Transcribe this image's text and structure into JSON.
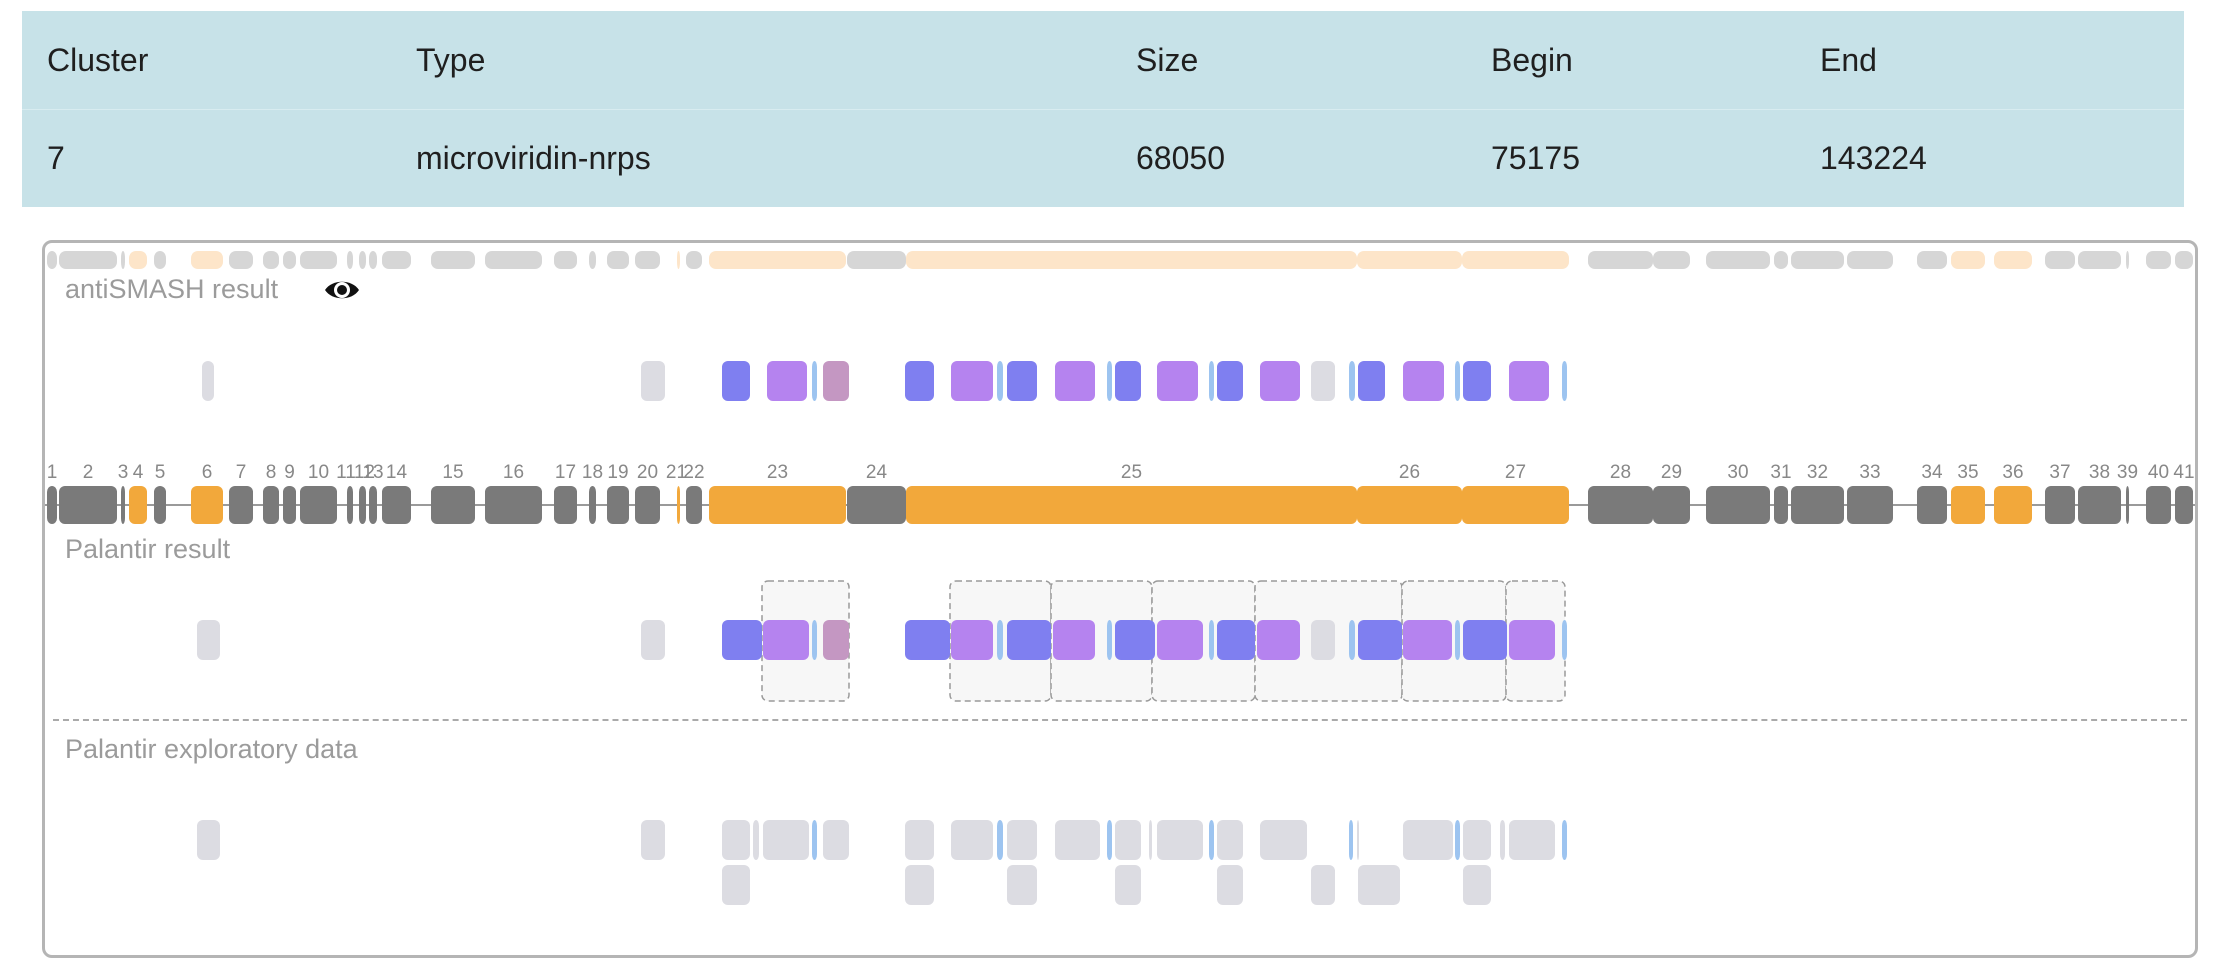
{
  "table": {
    "headers": [
      "Cluster",
      "Type",
      "Size",
      "Begin",
      "End"
    ],
    "row": [
      "7",
      "microviridin-nrps",
      "68050",
      "75175",
      "143224"
    ]
  },
  "viewer": {
    "antismash_label": "antiSMASH result",
    "palantir_label": "Palantir result",
    "exploratory_label": "Palantir exploratory data",
    "eye_icon": "eye-icon"
  },
  "colors": {
    "gene_core": "#f2a83b",
    "gene_other": "#7a7a7a",
    "gene_core_light": "#fde5c9",
    "gene_other_light": "#d6d6d6",
    "domain_blue": "#7f7ff0",
    "domain_violet": "#b583ef",
    "domain_mauve": "#c497c2",
    "domain_thin": "#9dc4f0",
    "domain_grey": "#dcdce2",
    "module_box": "#9a9a9a",
    "table_bg": "#c7e2e8"
  },
  "genes": [
    {
      "label": "1",
      "core": false
    },
    {
      "label": "2",
      "core": false
    },
    {
      "label": "3",
      "core": false
    },
    {
      "label": "4",
      "core": true
    },
    {
      "label": "5",
      "core": false
    },
    {
      "label": "6",
      "core": true
    },
    {
      "label": "7",
      "core": false
    },
    {
      "label": "8",
      "core": false
    },
    {
      "label": "9",
      "core": false
    },
    {
      "label": "10",
      "core": false
    },
    {
      "label": "11",
      "core": false
    },
    {
      "label": "12",
      "core": false
    },
    {
      "label": "13",
      "core": false
    },
    {
      "label": "14",
      "core": false
    },
    {
      "label": "15",
      "core": false
    },
    {
      "label": "16",
      "core": false
    },
    {
      "label": "17",
      "core": false
    },
    {
      "label": "18",
      "core": false
    },
    {
      "label": "19",
      "core": false
    },
    {
      "label": "20",
      "core": false
    },
    {
      "label": "21",
      "core": true
    },
    {
      "label": "22",
      "core": false
    },
    {
      "label": "23",
      "core": true
    },
    {
      "label": "24",
      "core": false
    },
    {
      "label": "25",
      "core": true
    },
    {
      "label": "26",
      "core": true
    },
    {
      "label": "27",
      "core": true
    },
    {
      "label": "28",
      "core": false
    },
    {
      "label": "29",
      "core": false
    },
    {
      "label": "30",
      "core": false
    },
    {
      "label": "31",
      "core": false
    },
    {
      "label": "32",
      "core": false
    },
    {
      "label": "33",
      "core": false
    },
    {
      "label": "34",
      "core": false
    },
    {
      "label": "35",
      "core": true
    },
    {
      "label": "36",
      "core": true
    },
    {
      "label": "37",
      "core": false
    },
    {
      "label": "38",
      "core": false
    },
    {
      "label": "39",
      "core": false
    },
    {
      "label": "40",
      "core": false
    },
    {
      "label": "41",
      "core": false
    }
  ]
}
